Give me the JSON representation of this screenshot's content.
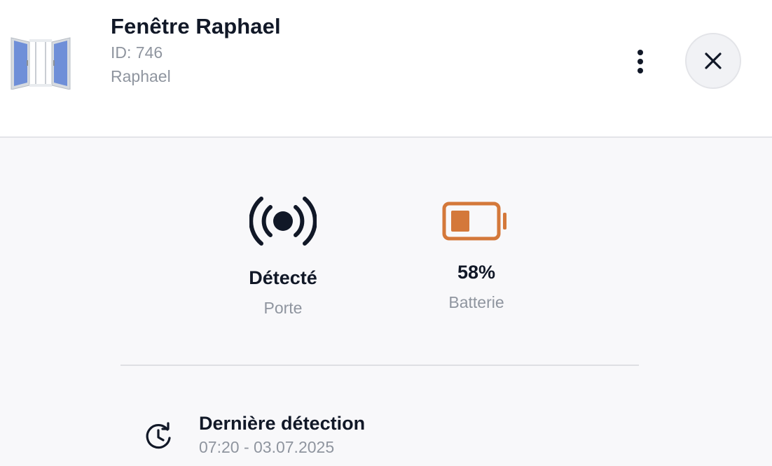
{
  "header": {
    "title": "Fenêtre Raphael",
    "id_text": "ID: 746",
    "owner": "Raphael",
    "device_icon": "window-icon",
    "more_icon": "more-vertical-icon",
    "close_icon": "close-icon"
  },
  "stats": {
    "sensor": {
      "icon": "signal-detected-icon",
      "value": "Détecté",
      "label": "Porte"
    },
    "battery": {
      "icon": "battery-icon",
      "value": "58%",
      "label": "Batterie",
      "level": 0.58,
      "color": "#d4783a"
    }
  },
  "history": {
    "icon": "history-clock-icon",
    "title": "Dernière détection",
    "time": "07:20 - 03.07.2025"
  },
  "colors": {
    "primary_text": "#111827",
    "secondary_text": "#8f959f",
    "battery_orange": "#d4783a",
    "window_glass": "#6f8fd8"
  }
}
